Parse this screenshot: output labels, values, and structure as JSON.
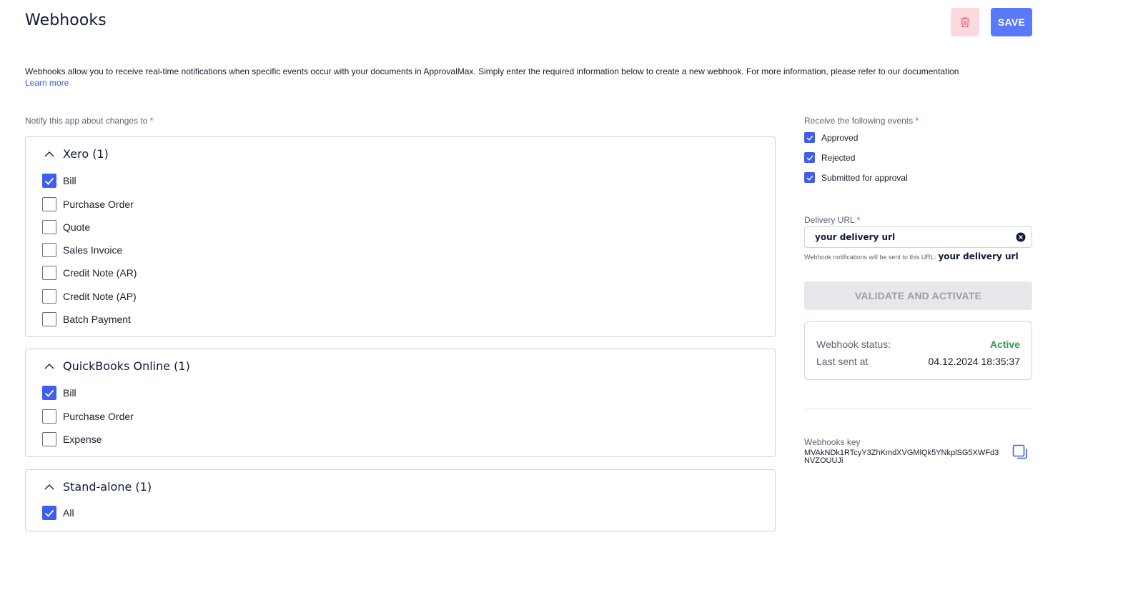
{
  "page": {
    "title": "Webhooks",
    "intro_text": "Webhooks allow you to receive real-time notifications when specific events occur with your documents in ApprovalMax. Simply enter the required information below to create a new webhook. For more information, please refer to our documentation",
    "learn_more": "Learn more"
  },
  "toolbar": {
    "delete_icon": "trash-icon",
    "save_label": "SAVE"
  },
  "notify": {
    "label": "Notify this app about changes to",
    "required_mark": "*",
    "groups": [
      {
        "title": "Xero (1)",
        "expanded": true,
        "items": [
          {
            "label": "Bill",
            "checked": true
          },
          {
            "label": "Purchase Order",
            "checked": false
          },
          {
            "label": "Quote",
            "checked": false
          },
          {
            "label": "Sales Invoice",
            "checked": false
          },
          {
            "label": "Credit Note (AR)",
            "checked": false
          },
          {
            "label": "Credit Note (AP)",
            "checked": false
          },
          {
            "label": "Batch Payment",
            "checked": false
          }
        ]
      },
      {
        "title": "QuickBooks Online (1)",
        "expanded": true,
        "items": [
          {
            "label": "Bill",
            "checked": true
          },
          {
            "label": "Purchase Order",
            "checked": false
          },
          {
            "label": "Expense",
            "checked": false
          }
        ]
      },
      {
        "title": "Stand-alone (1)",
        "expanded": true,
        "items": [
          {
            "label": "All",
            "checked": true
          }
        ]
      }
    ]
  },
  "events": {
    "label": "Receive the following events",
    "required_mark": "*",
    "items": [
      {
        "label": "Approved",
        "checked": true
      },
      {
        "label": "Rejected",
        "checked": true
      },
      {
        "label": "Submitted for approval",
        "checked": true
      }
    ]
  },
  "delivery": {
    "label": "Delivery URL",
    "required_mark": "*",
    "value": "your delivery url",
    "hint_text": "Webhook notifications will be sent to this URL:",
    "hint_value": "your delivery url"
  },
  "validate": {
    "label": "VALIDATE AND ACTIVATE",
    "disabled": true
  },
  "status": {
    "status_label": "Webhook status:",
    "status_value": "Active",
    "last_sent_label": "Last sent at",
    "last_sent_value": "04.12.2024 18:35:37"
  },
  "key": {
    "label": "Webhooks key",
    "value": "MVAkNDk1RTcyY3ZhKmdXVGMlQk5YNkplSG5XWFd3NVZOUUJi"
  },
  "colors": {
    "accent": "#3f5ef1",
    "save": "#5a78fb",
    "delete_bg": "#fbd9de",
    "delete_icon": "#e86a7c",
    "active": "#2e9a4d",
    "required": "#e0374a"
  }
}
